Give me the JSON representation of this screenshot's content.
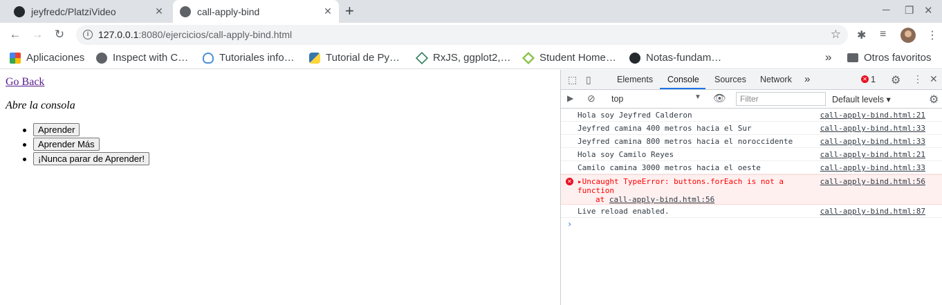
{
  "tabs": [
    {
      "title": "jeyfredc/PlatziVideo",
      "close": "✕"
    },
    {
      "title": "call-apply-bind",
      "close": "✕"
    }
  ],
  "new_tab": "+",
  "window_controls": {
    "minimize": "─",
    "restore": "❐",
    "close": "✕"
  },
  "toolbar": {
    "back": "←",
    "forward": "→",
    "reload": "↻",
    "url_host": "127.0.0.1",
    "url_rest": ":8080/ejercicios/call-apply-bind.html",
    "info": "i",
    "star": "☆",
    "extensions": "✱",
    "media": "≡",
    "menu": "⋮"
  },
  "bookmarks": [
    {
      "label": "Aplicaciones",
      "icon": "apps-grid-icon"
    },
    {
      "label": "Inspect with C…",
      "icon": "globe-icon"
    },
    {
      "label": "Tutoriales info…",
      "icon": "bulb-icon"
    },
    {
      "label": "Tutorial de Py…",
      "icon": "python-icon"
    },
    {
      "label": "RxJS, ggplot2,…",
      "icon": "diamond-icon"
    },
    {
      "label": "Student Home…",
      "icon": "student-icon"
    },
    {
      "label": "Notas-fundam…",
      "icon": "github-icon"
    }
  ],
  "bookmarks_more": "»",
  "other_bookmarks": "Otros favoritos",
  "page": {
    "go_back": "Go Back",
    "subtitle": "Abre la consola",
    "buttons": [
      "Aprender",
      "Aprender Más",
      "¡Nunca parar de Aprender!"
    ]
  },
  "devtools": {
    "tabs": [
      "Elements",
      "Console",
      "Sources",
      "Network"
    ],
    "active_tab": "Console",
    "more_tabs": "»",
    "error_count": "1",
    "context": "top",
    "filter_placeholder": "Filter",
    "levels": "Default levels ▾",
    "messages": [
      {
        "text": "Hola soy Jeyfred Calderon",
        "source": "call-apply-bind.html:21"
      },
      {
        "text": "Jeyfred camina 400 metros hacia el Sur",
        "source": "call-apply-bind.html:33"
      },
      {
        "text": "Jeyfred camina 800 metros hacia el noroccidente",
        "source": "call-apply-bind.html:33"
      },
      {
        "text": "Hola soy Camilo Reyes",
        "source": "call-apply-bind.html:21"
      },
      {
        "text": "Camilo camina 3000 metros hacia el oeste",
        "source": "call-apply-bind.html:33"
      }
    ],
    "error": {
      "text": "▸Uncaught TypeError: buttons.forEach is not a function",
      "stack_prefix": "at ",
      "stack_link": "call-apply-bind.html:56",
      "source": "call-apply-bind.html:56"
    },
    "last_message": {
      "text": "Live reload enabled.",
      "source": "call-apply-bind.html:87"
    },
    "prompt": "›"
  }
}
